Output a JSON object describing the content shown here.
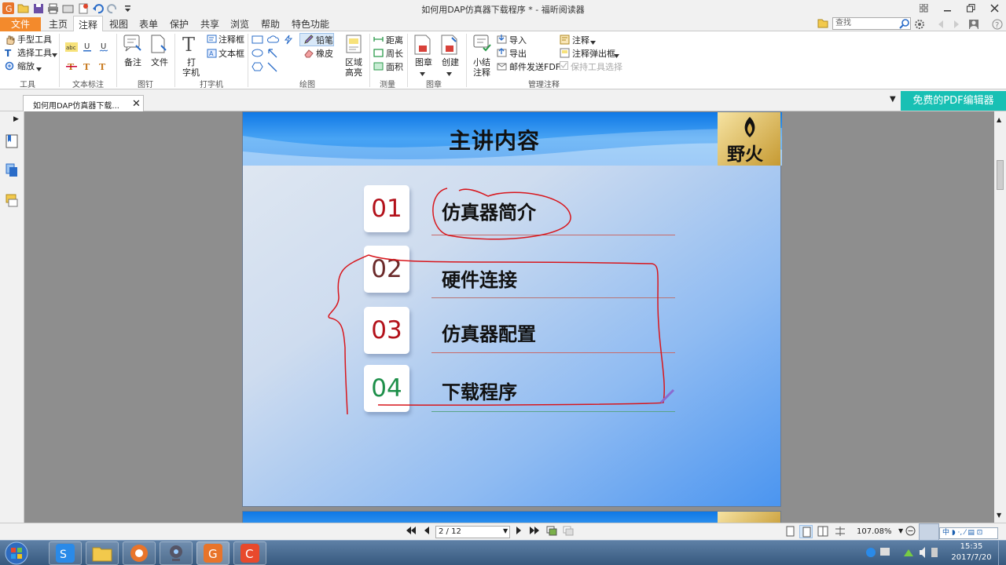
{
  "window": {
    "title": "如何用DAP仿真器下载程序 * - 福昕阅读器"
  },
  "menubar": {
    "file_label": "文件",
    "tabs": [
      "主页",
      "注释",
      "视图",
      "表单",
      "保护",
      "共享",
      "浏览",
      "帮助",
      "特色功能"
    ],
    "active_tab": "注释",
    "search_placeholder": "查找"
  },
  "ribbon": {
    "tools": {
      "hand": "手型工具",
      "select": "选择工具",
      "zoom": "缩放",
      "group": "工具"
    },
    "text_markup": {
      "group": "文本标注",
      "glyphs": [
        "abc",
        "U",
        "U",
        "T",
        "T",
        "T"
      ]
    },
    "pin": {
      "note": "备注",
      "file": "文件",
      "group": "图钉"
    },
    "typewriter": {
      "typewriter_line1": "打",
      "typewriter_line2": "字机",
      "callout": "注释框",
      "textbox": "文本框",
      "group": "打字机"
    },
    "drawing": {
      "pencil": "铅笔",
      "eraser": "橡皮",
      "area_line1": "区域",
      "area_line2": "高亮",
      "group": "绘图"
    },
    "measure": {
      "distance": "距离",
      "perimeter": "周长",
      "area": "面积",
      "group": "测量"
    },
    "stamp": {
      "stamp": "图章",
      "create": "创建",
      "group": "图章"
    },
    "manage": {
      "summary_line1": "小结",
      "summary_line2": "注释",
      "import": "导入",
      "export": "导出",
      "email_fdf": "邮件发送FDF",
      "comments": "注释",
      "popup": "注释弹出框",
      "keep_tool": "保持工具选择",
      "group": "管理注释"
    }
  },
  "tabbar": {
    "doc_tab": "如何用DAP仿真器下载...",
    "promo": "免费的PDF编辑器"
  },
  "slide": {
    "title": "主讲内容",
    "logo_text": "野火",
    "items": [
      {
        "num": "01",
        "label": "仿真器简介",
        "num_color": "#b3111a",
        "line_color": "#c86a6a"
      },
      {
        "num": "02",
        "label": "硬件连接",
        "num_color": "#6b2a2a",
        "line_color": "#b87474"
      },
      {
        "num": "03",
        "label": "仿真器配置",
        "num_color": "#b3111a",
        "line_color": "#c86a6a"
      },
      {
        "num": "04",
        "label": "下载程序",
        "num_color": "#1d8f49",
        "line_color": "#5aa486"
      }
    ]
  },
  "statusbar": {
    "page": "2 / 12",
    "zoom": "107.08%"
  },
  "taskbar": {
    "time": "15:35",
    "date": "2017/7/20",
    "ime": "中 ◗ ·, ⁄ ▤ ⊡"
  },
  "colors": {
    "accent": "#f38a2c",
    "promo": "#18c0b4",
    "ink": "#d8161c"
  }
}
